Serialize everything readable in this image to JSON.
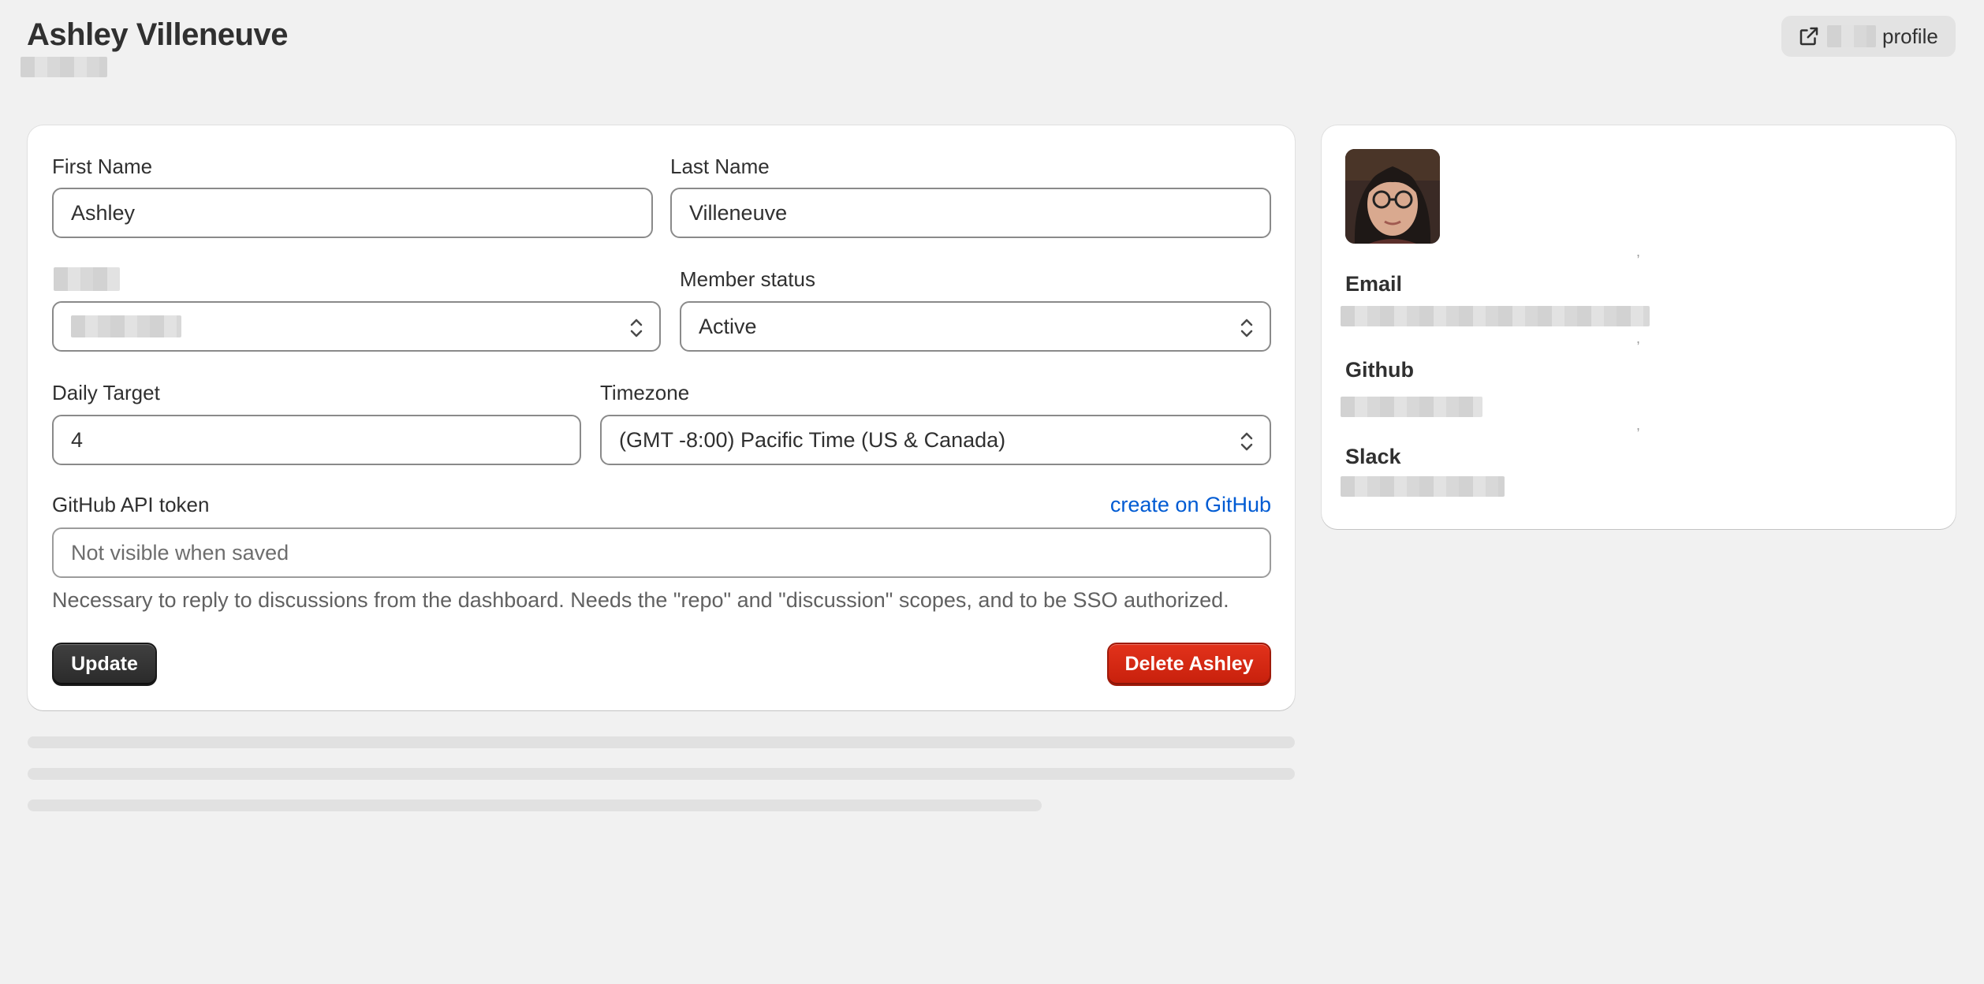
{
  "header": {
    "title": "Ashley Villeneuve",
    "profile_button_label": "profile"
  },
  "form": {
    "first_name": {
      "label": "First Name",
      "value": "Ashley"
    },
    "last_name": {
      "label": "Last Name",
      "value": "Villeneuve"
    },
    "member_status": {
      "label": "Member status",
      "value": "Active"
    },
    "daily_target": {
      "label": "Daily Target",
      "value": "4"
    },
    "timezone": {
      "label": "Timezone",
      "value": "(GMT -8:00) Pacific Time (US & Canada)"
    },
    "github_token": {
      "label": "GitHub API token",
      "link_label": "create on GitHub",
      "placeholder": "Not visible when saved",
      "help_text": "Necessary to reply to discussions from the dashboard. Needs the \"repo\" and \"discussion\" scopes, and to be SSO authorized."
    },
    "update_label": "Update",
    "delete_label": "Delete Ashley"
  },
  "sidebar": {
    "email_label": "Email",
    "github_label": "Github",
    "slack_label": "Slack"
  },
  "colors": {
    "background": "#f1f1f1",
    "link": "#005bd3",
    "primary_button": "#303030",
    "destructive_button": "#d22e1b"
  }
}
